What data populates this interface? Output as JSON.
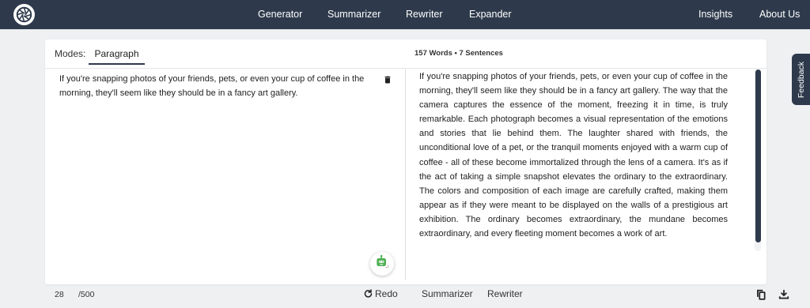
{
  "nav": {
    "logo_icon": "shutter-logo-icon",
    "links": [
      {
        "label": "Generator"
      },
      {
        "label": "Summarizer"
      },
      {
        "label": "Rewriter"
      },
      {
        "label": "Expander"
      },
      {
        "label": "Insights"
      },
      {
        "label": "About Us"
      }
    ]
  },
  "editor": {
    "modes_label": "Modes:",
    "mode": "Paragraph",
    "stats": "157 Words • 7 Sentences",
    "input_text": "If you're snapping photos of your friends, pets, or even your cup of coffee in the morning, they'll seem like they should be in a fancy art gallery.",
    "char_count": "28",
    "char_limit": "/500",
    "redo_label": "Redo",
    "output_text": "If you're snapping photos of your friends, pets, or even your cup of coffee in the morning, they'll seem like they should be in a fancy art gallery. The way that the camera captures the essence of the moment, freezing it in time, is truly remarkable. Each photograph becomes a visual representation of the emotions and stories that lie behind them. The laughter shared with friends, the unconditional love of a pet, or the tranquil moments enjoyed with a warm cup of coffee - all of these become immortalized through the lens of a camera. It's as if the act of taking a simple snapshot elevates the ordinary to the extraordinary. The colors and composition of each image are carefully crafted, making them appear as if they were meant to be displayed on the walls of a prestigious art exhibition. The ordinary becomes extraordinary, the mundane becomes extraordinary, and every fleeting moment becomes a work of art.",
    "output_tabs": [
      {
        "label": "Summarizer"
      },
      {
        "label": "Rewriter"
      }
    ],
    "icons": [
      "trash-icon",
      "robot-assistant-icon",
      "redo-icon",
      "copy-icon",
      "download-icon"
    ]
  },
  "feedback": {
    "label": "Feedback"
  },
  "colors": {
    "navbar": "#2e3a4c",
    "background": "#eef0f2",
    "bot_accent": "#4caf50"
  }
}
